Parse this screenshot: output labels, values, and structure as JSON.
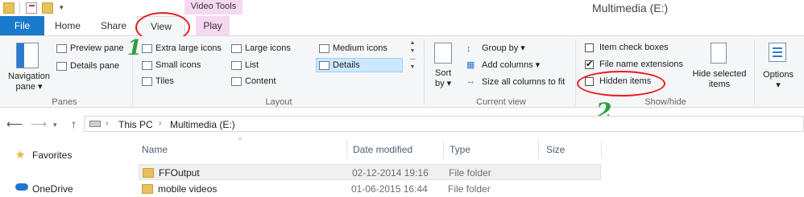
{
  "window": {
    "title": "Multimedia (E:)",
    "context_tab_label": "Video Tools"
  },
  "tabs": {
    "file": "File",
    "home": "Home",
    "share": "Share",
    "view": "View",
    "play": "Play"
  },
  "ribbon": {
    "panes": {
      "label": "Panes",
      "navigation_pane": "Navigation pane",
      "preview_pane": "Preview pane",
      "details_pane": "Details pane"
    },
    "layout": {
      "label": "Layout",
      "extra_large_icons": "Extra large icons",
      "large_icons": "Large icons",
      "medium_icons": "Medium icons",
      "small_icons": "Small icons",
      "list": "List",
      "details": "Details",
      "tiles": "Tiles",
      "content": "Content",
      "selected": "Details"
    },
    "current_view": {
      "label": "Current view",
      "sort_by": "Sort by",
      "group_by": "Group by",
      "add_columns": "Add columns",
      "size_all_columns": "Size all columns to fit"
    },
    "show_hide": {
      "label": "Show/hide",
      "item_check_boxes": "Item check boxes",
      "item_check_boxes_checked": false,
      "file_name_extensions": "File name extensions",
      "file_name_extensions_checked": true,
      "hidden_items": "Hidden items",
      "hidden_items_checked": false,
      "hide_selected_items": "Hide selected items"
    },
    "options": {
      "label": "Options"
    }
  },
  "annotations": {
    "step1": "1",
    "step2": "2"
  },
  "address": {
    "crumbs": [
      "This PC",
      "Multimedia (E:)"
    ]
  },
  "nav_pane": {
    "items": [
      "Favorites",
      "OneDrive"
    ]
  },
  "file_list": {
    "columns": [
      "Name",
      "Date modified",
      "Type",
      "Size"
    ],
    "rows": [
      {
        "name": "FFOutput",
        "date": "02-12-2014 19:16",
        "type": "File folder",
        "size": ""
      },
      {
        "name": "mobile videos",
        "date": "01-06-2015 16:44",
        "type": "File folder",
        "size": ""
      }
    ]
  },
  "colors": {
    "accent": "#1979ca",
    "context_tab": "#f6d8f0",
    "annotation_red": "#e51c23",
    "annotation_green": "#2ea043"
  }
}
